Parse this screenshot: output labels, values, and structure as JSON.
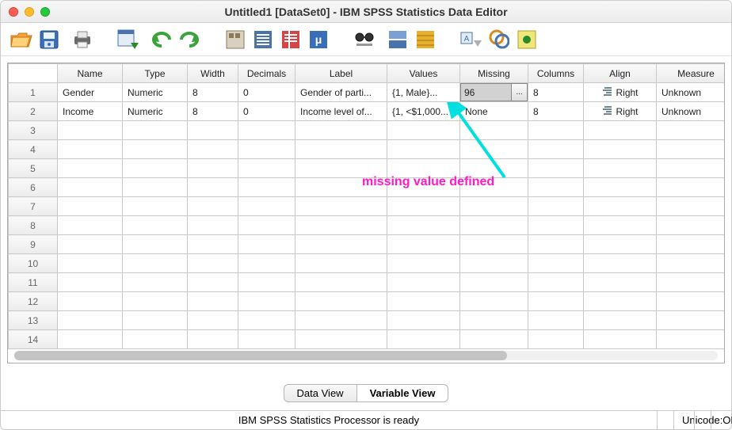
{
  "window": {
    "title": "Untitled1 [DataSet0] - IBM SPSS Statistics Data Editor"
  },
  "toolbar_icons": [
    "open",
    "save",
    "print",
    "recall",
    "undo",
    "redo",
    "goto-case",
    "goto-var",
    "variables",
    "run-descriptives",
    "find",
    "split-file",
    "weight",
    "select-cases",
    "value-labels",
    "use-sets",
    "show-all",
    "spell"
  ],
  "columns": [
    "Name",
    "Type",
    "Width",
    "Decimals",
    "Label",
    "Values",
    "Missing",
    "Columns",
    "Align",
    "Measure"
  ],
  "rows": [
    {
      "num": "1",
      "name": "Gender",
      "type": "Numeric",
      "width": "8",
      "decimals": "0",
      "label": "Gender of parti...",
      "values": "{1, Male}...",
      "missing": "96",
      "missing_editing": true,
      "cols": "8",
      "align": "Right",
      "measure": "Unknown"
    },
    {
      "num": "2",
      "name": "Income",
      "type": "Numeric",
      "width": "8",
      "decimals": "0",
      "label": "Income level of...",
      "values": "{1, <$1,000...",
      "missing": "None",
      "missing_editing": false,
      "cols": "8",
      "align": "Right",
      "measure": "Unknown"
    }
  ],
  "empty_row_count": 12,
  "tabs": {
    "data": "Data View",
    "variable": "Variable View",
    "active": "variable"
  },
  "status": {
    "processor": "IBM SPSS Statistics Processor is ready",
    "unicode": "Unicode:ON"
  },
  "annotation": {
    "text": "missing value defined"
  },
  "ellipsis": "..."
}
